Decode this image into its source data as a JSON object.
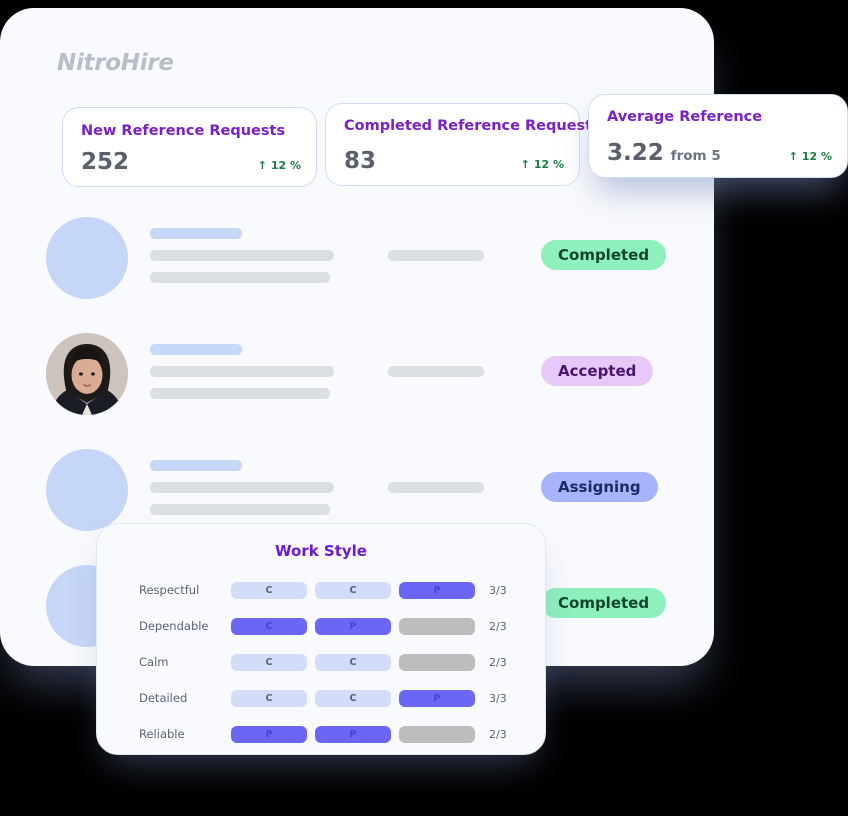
{
  "brand": {
    "name": "NitroHire"
  },
  "stats": [
    {
      "title": "New Reference Requests",
      "value": "252",
      "suffix": "",
      "delta_arrow": "↑",
      "delta": "12 %"
    },
    {
      "title": "Completed Reference Requests",
      "value": "83",
      "suffix": "",
      "delta_arrow": "↑",
      "delta": "12 %"
    },
    {
      "title": "Average Reference",
      "value": "3.22",
      "suffix": "from 5",
      "delta_arrow": "↑",
      "delta": "12 %"
    }
  ],
  "rows": [
    {
      "avatar": "placeholder-avatar",
      "status": "Completed",
      "status_kind": "completed"
    },
    {
      "avatar": "photo-avatar",
      "status": "Accepted",
      "status_kind": "accepted"
    },
    {
      "avatar": "placeholder-avatar",
      "status": "Assigning",
      "status_kind": "assigning"
    },
    {
      "avatar": "placeholder-avatar",
      "status": "Completed",
      "status_kind": "completed"
    }
  ],
  "work_style": {
    "title": "Work Style",
    "traits": [
      {
        "label": "Respectful",
        "marks": [
          "C",
          "C",
          "P"
        ],
        "fills": [
          "light",
          "light",
          "solid"
        ],
        "score": "3/3"
      },
      {
        "label": "Dependable",
        "marks": [
          "C",
          "P",
          ""
        ],
        "fills": [
          "solid",
          "solid",
          "empty"
        ],
        "score": "2/3"
      },
      {
        "label": "Calm",
        "marks": [
          "C",
          "C",
          ""
        ],
        "fills": [
          "light",
          "light",
          "empty"
        ],
        "score": "2/3"
      },
      {
        "label": "Detailed",
        "marks": [
          "C",
          "C",
          "P"
        ],
        "fills": [
          "light",
          "light",
          "solid"
        ],
        "score": "3/3"
      },
      {
        "label": "Reliable",
        "marks": [
          "P",
          "P",
          ""
        ],
        "fills": [
          "solid",
          "solid",
          "empty"
        ],
        "score": "2/3"
      }
    ]
  },
  "colors": {
    "accent_purple": "#7a20c9",
    "indigo": "#6b66f6",
    "mint": "#8ef0bd",
    "lavender": "#e6c9f8",
    "periwinkle": "#a6b5fb",
    "positive_green": "#1d7a46"
  }
}
